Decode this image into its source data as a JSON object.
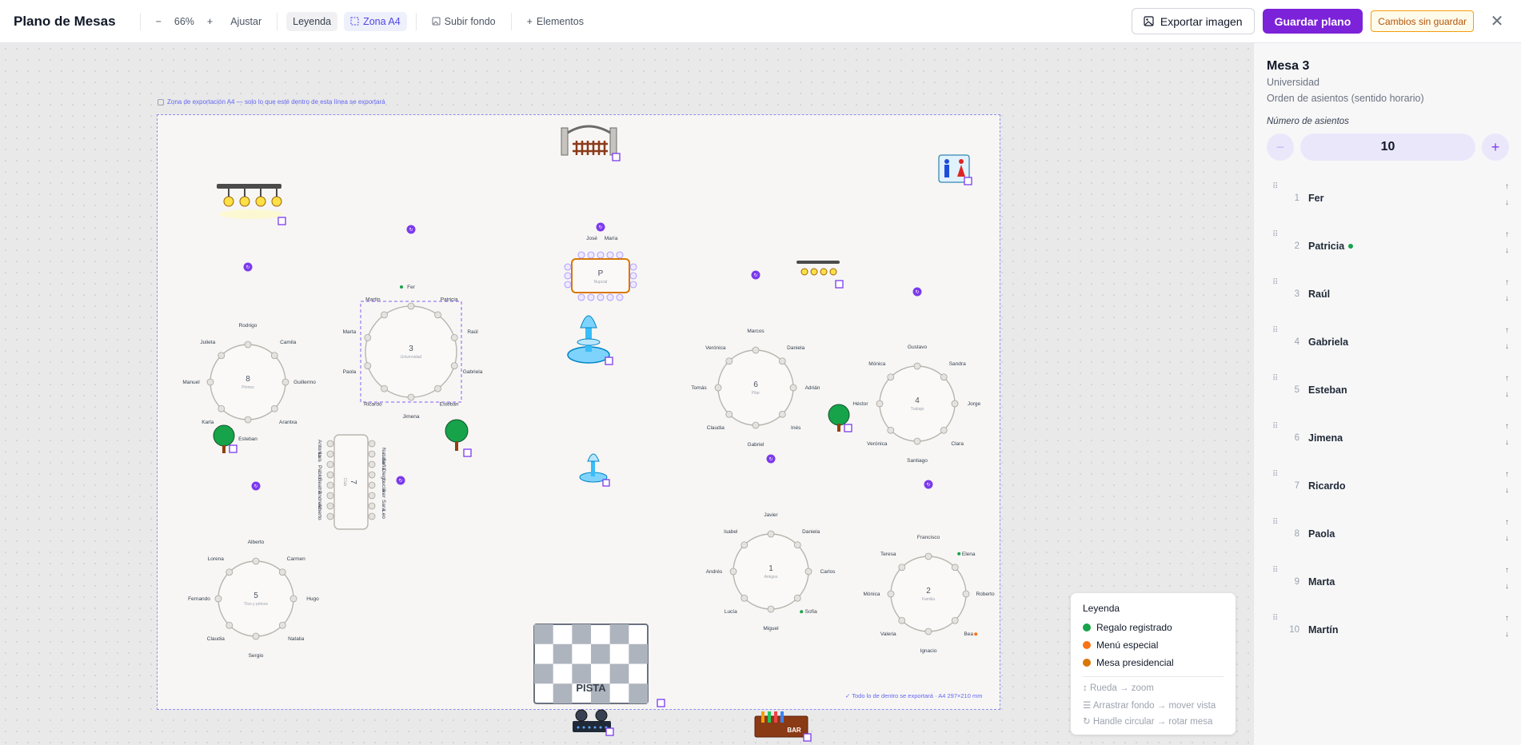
{
  "toolbar": {
    "title": "Plano de Mesas",
    "zoom_out": "−",
    "zoom_level": "66%",
    "zoom_in": "+",
    "fit": "Ajustar",
    "legend": "Leyenda",
    "zone_a4": "Zona A4",
    "upload_bg": "Subir fondo",
    "elements": "Elementos",
    "export_image": "Exportar imagen",
    "save": "Guardar plano",
    "unsaved": "Cambios sin guardar",
    "close": "✕"
  },
  "canvas": {
    "zone_label": "Zona de exportación A4 — solo lo que esté dentro de esta línea se exportará",
    "zone_footer": "✓ Todo lo de dentro se exportará · A4 297×210 mm",
    "dance_floor": "PISTA",
    "bar": "BAR",
    "tables": [
      {
        "number": "8",
        "group": "Primos",
        "guests": [
          "Rodrigo",
          "Camila",
          "Guillermo",
          "Arantxa",
          "Esteban",
          "Karla",
          "Manuel",
          "Julieta"
        ]
      },
      {
        "number": "3",
        "group": "Universidad",
        "guests": [
          "Fer",
          "Patricia",
          "Raúl",
          "Gabriela",
          "Esteban",
          "Jimena",
          "Ricardo",
          "Paola",
          "Marta",
          "Martín"
        ]
      },
      {
        "number": "P",
        "group": "Nupcial",
        "guests": [
          "José",
          "María"
        ]
      },
      {
        "number": "6",
        "group": "Pilar",
        "guests": [
          "Marcos",
          "Daniela",
          "Adrián",
          "Inés",
          "Gabriel",
          "Claudia",
          "Tomás",
          "Verónica"
        ]
      },
      {
        "number": "4",
        "group": "Trabajo",
        "guests": [
          "Gustavo",
          "Sandra",
          "Jorge",
          "Clara",
          "Santiago",
          "Verónica",
          "Héctor",
          "Mónica"
        ]
      },
      {
        "number": "7",
        "group": "Club",
        "guests": [
          "Natalia",
          "Sofía",
          "Diego",
          "Lucía",
          "Iker",
          "Sara",
          "Leo",
          "Antonio",
          "Luis",
          "Pablo",
          "Beatriz",
          "Andrea",
          "Alberto"
        ]
      },
      {
        "number": "5",
        "group": "Tíos y primos",
        "guests": [
          "Alberto",
          "Carmen",
          "Hugo",
          "Natalia",
          "Sergio",
          "Claudia",
          "Fernando",
          "Lorena"
        ]
      },
      {
        "number": "1",
        "group": "Amigos",
        "guests": [
          "Javier",
          "Daniela",
          "Carlos",
          "Sofía",
          "Miguel",
          "Lucía",
          "Andrés",
          "Isabel"
        ]
      },
      {
        "number": "2",
        "group": "Familia",
        "guests": [
          "Francisco",
          "Elena",
          "Roberto",
          "Bea",
          "Ignacio",
          "Valeria",
          "Mónica",
          "Teresa"
        ]
      }
    ]
  },
  "legend": {
    "title": "Leyenda",
    "items": [
      {
        "label": "Regalo registrado",
        "color": "#16a34a"
      },
      {
        "label": "Menú especial",
        "color": "#f97316"
      },
      {
        "label": "Mesa presidencial",
        "color": "#d97706"
      }
    ],
    "hints": [
      "↕ Rueda → zoom",
      "☰ Arrastrar fondo → mover vista",
      "↻ Handle circular → rotar mesa"
    ]
  },
  "panel": {
    "title": "Mesa 3",
    "subtitle": "Universidad",
    "order": "Orden de asientos (sentido horario)",
    "seats_label": "Número de asientos",
    "seats_value": "10",
    "minus": "−",
    "plus": "+",
    "guests": [
      {
        "num": "1",
        "name": "Fer"
      },
      {
        "num": "2",
        "name": "Patricia",
        "gift": true
      },
      {
        "num": "3",
        "name": "Raúl"
      },
      {
        "num": "4",
        "name": "Gabriela"
      },
      {
        "num": "5",
        "name": "Esteban"
      },
      {
        "num": "6",
        "name": "Jimena"
      },
      {
        "num": "7",
        "name": "Ricardo"
      },
      {
        "num": "8",
        "name": "Paola"
      },
      {
        "num": "9",
        "name": "Marta"
      },
      {
        "num": "10",
        "name": "Martín"
      }
    ]
  },
  "colors": {
    "accent": "#7c22d9",
    "zone": "#8b8ff0",
    "gift": "#16a34a",
    "special": "#f97316",
    "presidential": "#d97706"
  }
}
